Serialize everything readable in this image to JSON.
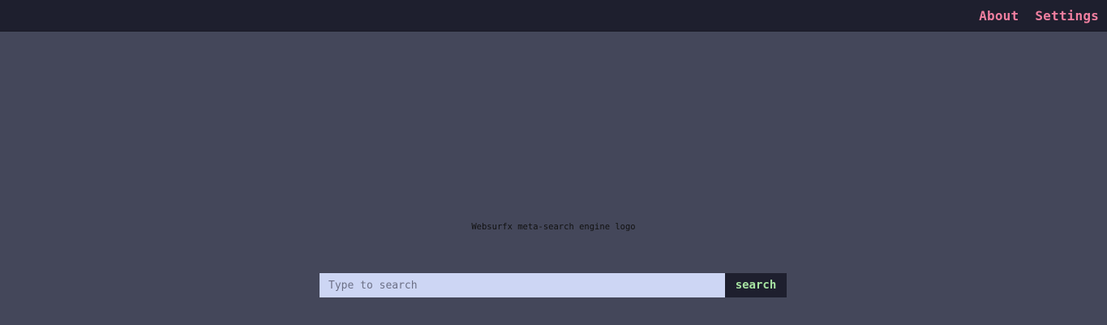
{
  "header": {
    "nav": [
      {
        "label": "About"
      },
      {
        "label": "Settings"
      }
    ]
  },
  "main": {
    "logo_alt": "Websurfx meta-search engine logo",
    "search": {
      "placeholder": "Type to search",
      "value": "",
      "button_label": "search"
    }
  },
  "colors": {
    "background": "#44475a",
    "topbar": "#1e1f2e",
    "nav_link": "#f07fa0",
    "input_bg": "#cdd6f4",
    "button_text": "#a6e3a1"
  }
}
